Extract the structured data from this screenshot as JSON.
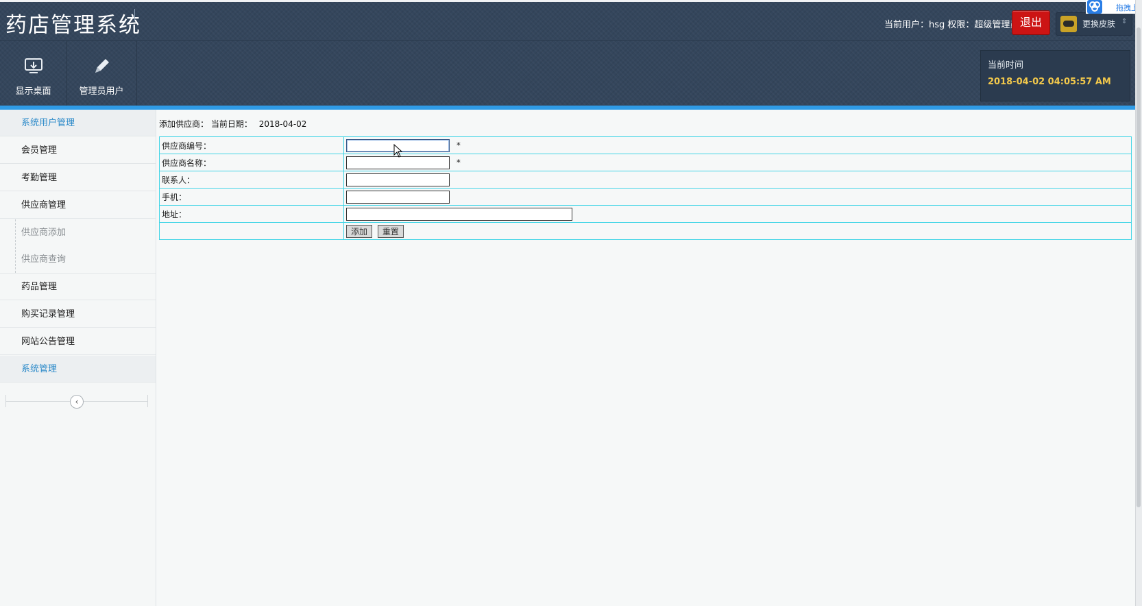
{
  "app": {
    "title": "药店管理系统"
  },
  "header": {
    "user_info": "当前用户：hsg 权限：超级管理员",
    "logout_label": "退出",
    "skin_label": "更换皮肤",
    "skin_caret": "⇕",
    "overlay_text": "拖拽上传",
    "toolbar": [
      {
        "label": "显示桌面",
        "icon": "monitor-icon"
      },
      {
        "label": "管理员用户",
        "icon": "pencil-icon"
      }
    ],
    "time_label": "当前时间",
    "time_value": "2018-04-02 04:05:57 AM"
  },
  "sidebar": {
    "items": [
      {
        "label": "系统用户管理",
        "active": true
      },
      {
        "label": "会员管理"
      },
      {
        "label": "考勤管理"
      },
      {
        "label": "供应商管理"
      },
      {
        "label": "药品管理"
      },
      {
        "label": "购买记录管理"
      },
      {
        "label": "网站公告管理"
      },
      {
        "label": "系统管理",
        "active": true
      }
    ],
    "sub_items": [
      "供应商添加",
      "供应商查询"
    ],
    "collapse_icon": "‹"
  },
  "main": {
    "crumb_title": "添加供应商：",
    "crumb_date_label": "当前日期：",
    "crumb_date": "2018-04-02",
    "fields": [
      {
        "label": "供应商编号：",
        "value": "",
        "required": "*"
      },
      {
        "label": "供应商名称：",
        "value": "",
        "required": "*"
      },
      {
        "label": "联系人：",
        "value": ""
      },
      {
        "label": "手机：",
        "value": ""
      },
      {
        "label": "地址：",
        "value": ""
      }
    ],
    "add_label": "添加",
    "reset_label": "重置"
  },
  "colors": {
    "header_bg": "#34465c",
    "accent_blue": "#2f9be6",
    "logout_red": "#cc1414",
    "time_gold": "#f2c84b",
    "table_border": "#3fd4e6",
    "active_link": "#2c8ac9"
  }
}
